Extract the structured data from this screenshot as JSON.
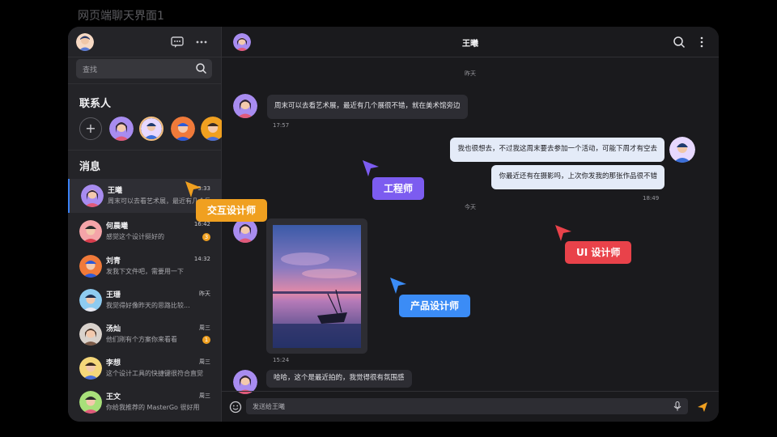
{
  "page_title": "网页端聊天界面1",
  "sidebar": {
    "search_placeholder": "查找",
    "contacts_title": "联系人",
    "messages_title": "消息",
    "add_symbol": "+",
    "conversations": [
      {
        "name": "王曦",
        "preview": "周末可以去看艺术展，最近有几个展很不错",
        "time": "3:33",
        "badge": ""
      },
      {
        "name": "何晨曦",
        "preview": "感觉这个设计挺好的",
        "time": "16:42",
        "badge": "3"
      },
      {
        "name": "刘青",
        "preview": "发我下文件吧，需要用一下",
        "time": "14:32",
        "badge": ""
      },
      {
        "name": "王珊",
        "preview": "我觉得好像昨天的思路比较...",
        "time": "昨天",
        "badge": ""
      },
      {
        "name": "汤灿",
        "preview": "他们刚有个方案你来看看",
        "time": "周三",
        "badge": "1"
      },
      {
        "name": "李想",
        "preview": "这个设计工具的快捷键很符合直觉",
        "time": "周三",
        "badge": ""
      },
      {
        "name": "王文",
        "preview": "你给我推荐的 MasterGo 很好用",
        "time": "周三",
        "badge": ""
      }
    ]
  },
  "chat": {
    "title": "王曦",
    "day_1": "昨天",
    "day_2": "今天",
    "messages": [
      {
        "dir": "in",
        "text": "周末可以去看艺术展，最近有几个展很不错，就在美术馆旁边",
        "time": "17:57"
      },
      {
        "dir": "out",
        "text": "我也很想去，不过我这周末要去参加一个活动，可能下周才有空去",
        "time": ""
      },
      {
        "dir": "out",
        "text": "你最近还有在摄影吗，上次你发我的那张作品很不错",
        "time": "18:49"
      },
      {
        "dir": "in",
        "text": "[image]",
        "time": "15:24"
      },
      {
        "dir": "in",
        "text": "哈哈，这个是最近拍的，我觉得很有氛围感",
        "time": ""
      }
    ],
    "composer_placeholder": "发送给王曦"
  },
  "tags": {
    "interaction": "交互设计师",
    "engineer": "工程师",
    "product": "产品设计师",
    "ui": "UI 设计师"
  },
  "colors": {
    "interaction": "#f0a020",
    "engineer": "#7c5cf0",
    "product": "#3b8cf6",
    "ui": "#e9424a"
  }
}
